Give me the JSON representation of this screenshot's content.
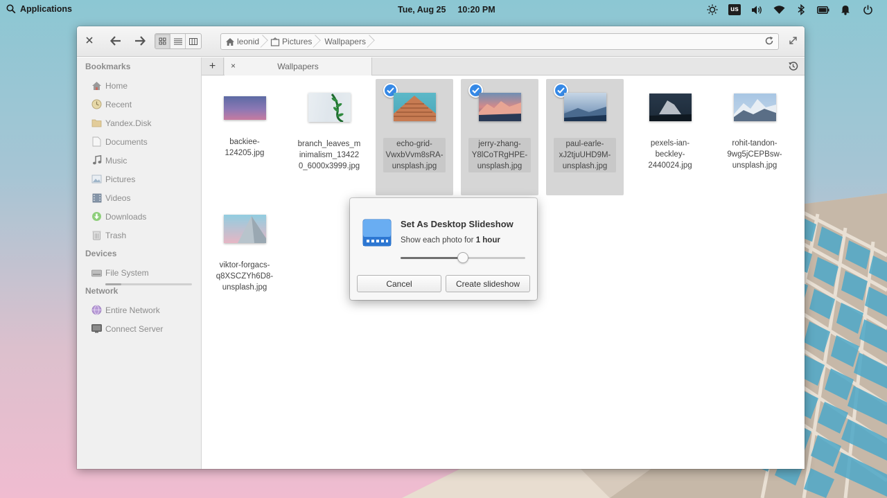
{
  "panel": {
    "applications_label": "Applications",
    "date": "Tue, Aug 25",
    "time": "10:20 PM",
    "keyboard_layout": "us",
    "tray_icons": [
      "night-light-icon",
      "keyboard-layout-indicator",
      "volume-icon",
      "wifi-icon",
      "bluetooth-icon",
      "battery-icon",
      "notifications-icon",
      "power-icon"
    ]
  },
  "path": {
    "crumbs": [
      "leonid",
      "Pictures",
      "Wallpapers"
    ]
  },
  "sidebar": {
    "bookmarks_heading": "Bookmarks",
    "bookmarks": [
      {
        "label": "Home",
        "icon": "home-icon"
      },
      {
        "label": "Recent",
        "icon": "recent-icon"
      },
      {
        "label": "Yandex.Disk",
        "icon": "folder-icon"
      },
      {
        "label": "Documents",
        "icon": "documents-icon"
      },
      {
        "label": "Music",
        "icon": "music-icon"
      },
      {
        "label": "Pictures",
        "icon": "pictures-icon"
      },
      {
        "label": "Videos",
        "icon": "videos-icon"
      },
      {
        "label": "Downloads",
        "icon": "downloads-icon"
      },
      {
        "label": "Trash",
        "icon": "trash-icon"
      }
    ],
    "devices_heading": "Devices",
    "devices": [
      {
        "label": "File System",
        "icon": "drive-icon",
        "usage_fraction": 0.18
      }
    ],
    "network_heading": "Network",
    "network": [
      {
        "label": "Entire Network",
        "icon": "network-icon"
      },
      {
        "label": "Connect Server",
        "icon": "server-icon"
      }
    ]
  },
  "tabs": {
    "add_label": "+",
    "close_label": "×",
    "active_tab": "Wallpapers"
  },
  "files": [
    {
      "name": "backiee-124205.jpg",
      "selected": false
    },
    {
      "name": "branch_leaves_minimalism_134220_6000x3999.jpg",
      "selected": false
    },
    {
      "name": "echo-grid-VwxbVvm8sRA-unsplash.jpg",
      "selected": true
    },
    {
      "name": "jerry-zhang-Y8lCoTRgHPE-unsplash.jpg",
      "selected": true
    },
    {
      "name": "paul-earle-xJ2tjuUHD9M-unsplash.jpg",
      "selected": true
    },
    {
      "name": "pexels-ian-beckley-2440024.jpg",
      "selected": false
    },
    {
      "name": "rohit-tandon-9wg5jCEPBsw-unsplash.jpg",
      "selected": false
    },
    {
      "name": "viktor-forgacs-q8XSCZYh6D8-unsplash.jpg",
      "selected": false
    }
  ],
  "dialog": {
    "title": "Set As Desktop Slideshow",
    "subtitle_prefix": "Show each photo for ",
    "duration": "1 hour",
    "slider_fraction": 0.5,
    "cancel_label": "Cancel",
    "create_label": "Create slideshow"
  }
}
